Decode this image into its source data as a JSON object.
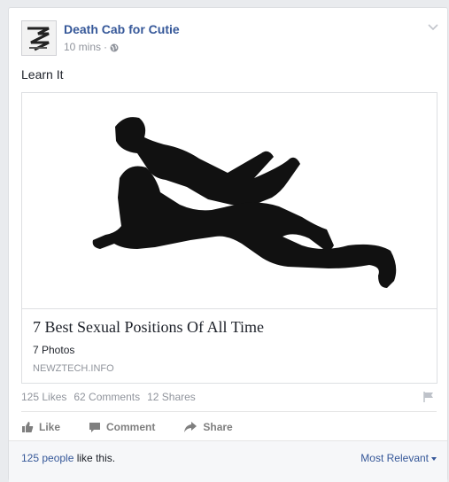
{
  "post": {
    "page_name": "Death Cab for Cutie",
    "time": "10 mins",
    "separator": "·",
    "privacy_icon": "globe-icon",
    "message": "Learn It"
  },
  "link_card": {
    "title": "7 Best Sexual Positions Of All Time",
    "subtitle": "7 Photos",
    "domain": "NEWZTECH.INFO"
  },
  "stats": {
    "likes": "125 Likes",
    "comments": "62 Comments",
    "shares": "12 Shares"
  },
  "actions": {
    "like": "Like",
    "comment": "Comment",
    "share": "Share"
  },
  "footer": {
    "people_link": "125 people",
    "likes_suffix": " like this.",
    "sort": "Most Relevant"
  },
  "colors": {
    "link_blue": "#365899",
    "muted_gray": "#90949c",
    "background": "#e9ebee"
  }
}
